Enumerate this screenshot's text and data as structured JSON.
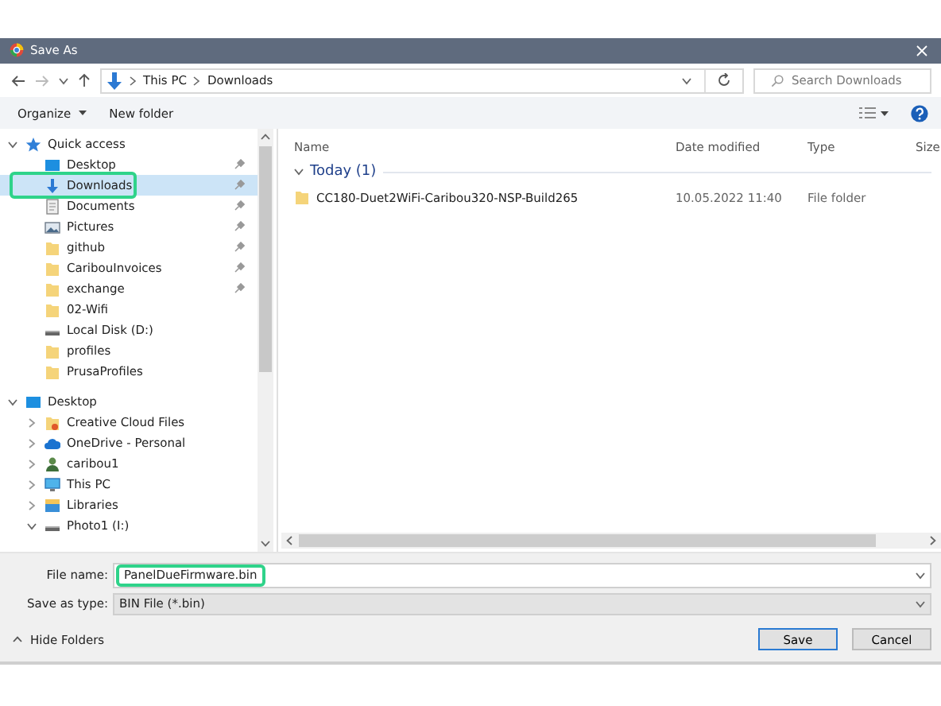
{
  "window": {
    "title": "Save As"
  },
  "address": {
    "path": [
      "This PC",
      "Downloads"
    ],
    "search_placeholder": "Search Downloads"
  },
  "toolbar": {
    "organize": "Organize",
    "new_folder": "New folder"
  },
  "sidebar": [
    {
      "label": "Quick access",
      "kind": "star",
      "expanded": true,
      "selected": false,
      "children": [
        {
          "label": "Desktop",
          "kind": "desktop",
          "pinned": true,
          "selected": false,
          "highlighted": false
        },
        {
          "label": "Downloads",
          "kind": "download",
          "pinned": true,
          "selected": true,
          "highlighted": true
        },
        {
          "label": "Documents",
          "kind": "documents",
          "pinned": true,
          "selected": false,
          "highlighted": false
        },
        {
          "label": "Pictures",
          "kind": "pictures",
          "pinned": true,
          "selected": false,
          "highlighted": false
        },
        {
          "label": "github",
          "kind": "folder",
          "pinned": true,
          "selected": false,
          "highlighted": false
        },
        {
          "label": "CaribouInvoices",
          "kind": "folder",
          "pinned": true,
          "selected": false,
          "highlighted": false
        },
        {
          "label": "exchange",
          "kind": "folder",
          "pinned": true,
          "selected": false,
          "highlighted": false
        },
        {
          "label": "02-Wifi",
          "kind": "folder",
          "pinned": false,
          "selected": false,
          "highlighted": false
        },
        {
          "label": "Local Disk (D:)",
          "kind": "drive",
          "pinned": false,
          "selected": false,
          "highlighted": false
        },
        {
          "label": "profiles",
          "kind": "folder",
          "pinned": false,
          "selected": false,
          "highlighted": false
        },
        {
          "label": "PrusaProfiles",
          "kind": "folder",
          "pinned": false,
          "selected": false,
          "highlighted": false
        }
      ]
    },
    {
      "label": "Desktop",
      "kind": "desktop",
      "expanded": true,
      "selected": false,
      "children": [
        {
          "label": "Creative Cloud Files",
          "kind": "ccfolder",
          "expanded": false,
          "selected": false
        },
        {
          "label": "OneDrive - Personal",
          "kind": "cloud",
          "expanded": false,
          "selected": false
        },
        {
          "label": "caribou1",
          "kind": "user",
          "expanded": false,
          "selected": false
        },
        {
          "label": "This PC",
          "kind": "pc",
          "expanded": false,
          "selected": false
        },
        {
          "label": "Libraries",
          "kind": "libraries",
          "expanded": false,
          "selected": false
        },
        {
          "label": "Photo1 (I:)",
          "kind": "drive",
          "expanded": true,
          "selected": false
        }
      ]
    }
  ],
  "file_list": {
    "columns": [
      "Name",
      "Date modified",
      "Type",
      "Size"
    ],
    "groups": [
      {
        "label": "Today (1)",
        "expanded": true,
        "rows": [
          {
            "name": "CC180-Duet2WiFi-Caribou320-NSP-Build265",
            "date": "10.05.2022 11:40",
            "type": "File folder"
          }
        ]
      }
    ]
  },
  "file_name": {
    "label": "File name:",
    "value": "PanelDueFirmware.bin",
    "highlighted": true
  },
  "save_type": {
    "label": "Save as type:",
    "value": "BIN File (*.bin)"
  },
  "hide_folders": "Hide Folders",
  "buttons": [
    "Save",
    "Cancel"
  ]
}
